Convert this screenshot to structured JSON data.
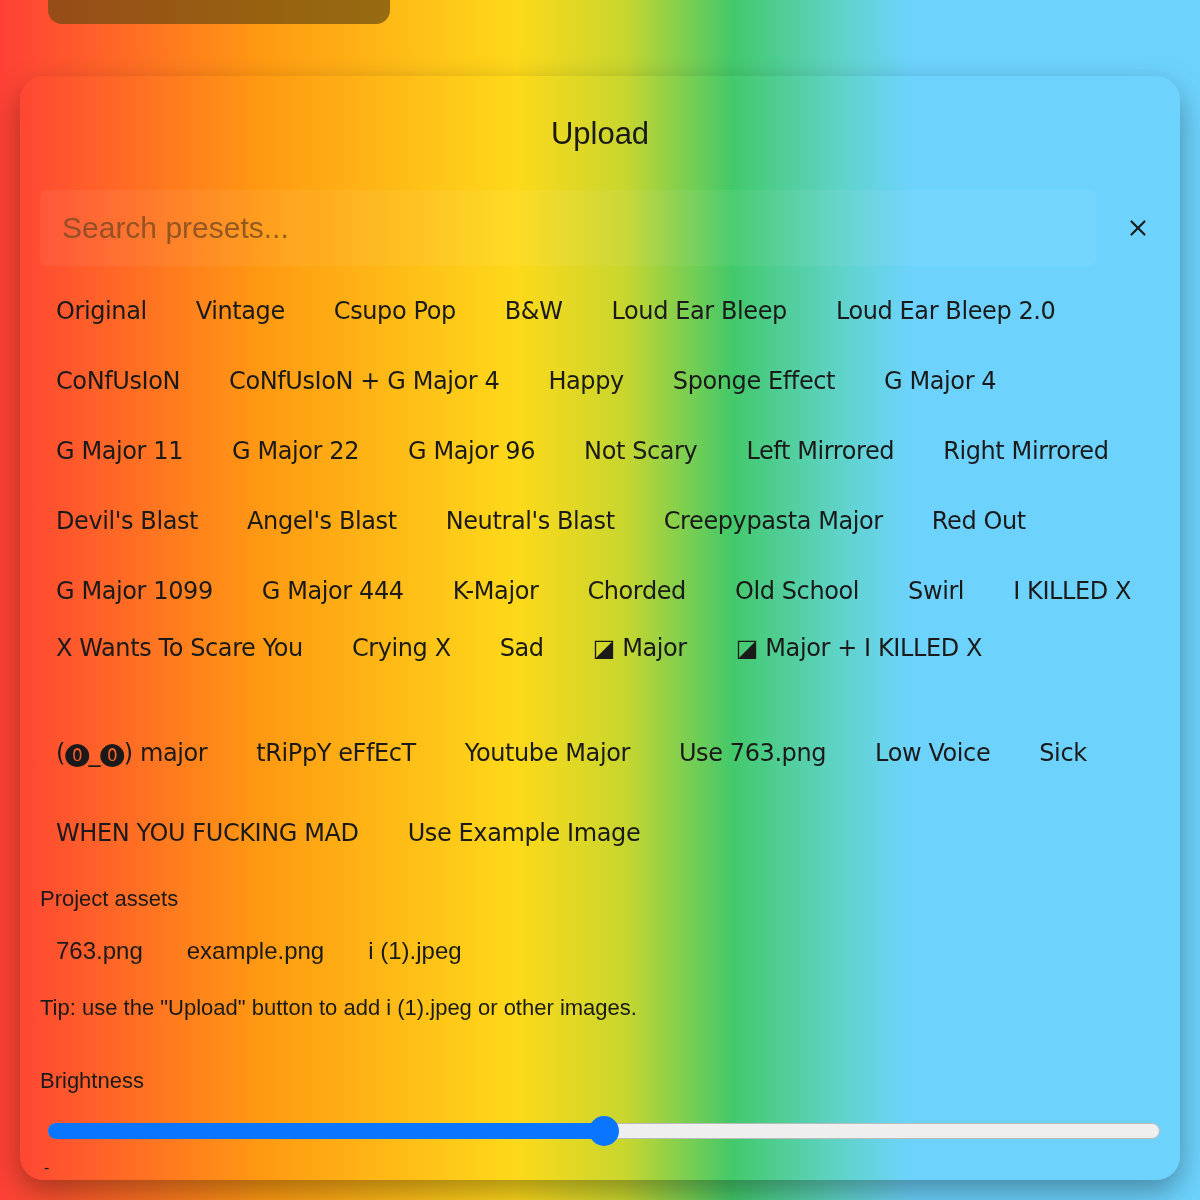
{
  "dialog": {
    "title": "Upload"
  },
  "search": {
    "placeholder": "Search presets..."
  },
  "preset_rows": [
    [
      "Original",
      "Vintage",
      "Csupo Pop",
      "B&W",
      "Loud Ear Bleep",
      "Loud Ear Bleep 2.0"
    ],
    [
      "CoNfUsIoN",
      "CoNfUsIoN + G Major 4",
      "Happy",
      "Sponge Effect",
      "G Major 4"
    ],
    [
      "G Major 11",
      "G Major 22",
      "G Major 96",
      "Not Scary",
      "Left Mirrored",
      "Right Mirrored"
    ],
    [
      "Devil's Blast",
      "Angel's Blast",
      "Neutral's Blast",
      "Creepypasta Major",
      "Red Out"
    ],
    [
      "G Major 1099",
      "G Major 444",
      "K-Major",
      "Chorded",
      "Old School",
      "Swirl",
      "I KILLED X"
    ],
    [
      "X Wants To Scare You",
      "Crying X",
      "Sad",
      "◪ Major",
      "◪ Major + I KILLED X"
    ],
    [
      "(⓿_⓿) major",
      "tRiPpY eFfEcT",
      "Youtube Major",
      "Use 763.png",
      "Low Voice",
      "Sick"
    ],
    [
      "WHEN YOU FUCKING MAD",
      "Use Example Image"
    ]
  ],
  "assets": {
    "heading": "Project assets",
    "files": [
      "763.png",
      "example.png",
      "i (1).jpeg"
    ],
    "tip": "Tip: use the \"Upload\" button to add i (1).jpeg or other images."
  },
  "brightness": {
    "label": "Brightness",
    "level": 0.5,
    "reading": "-"
  }
}
